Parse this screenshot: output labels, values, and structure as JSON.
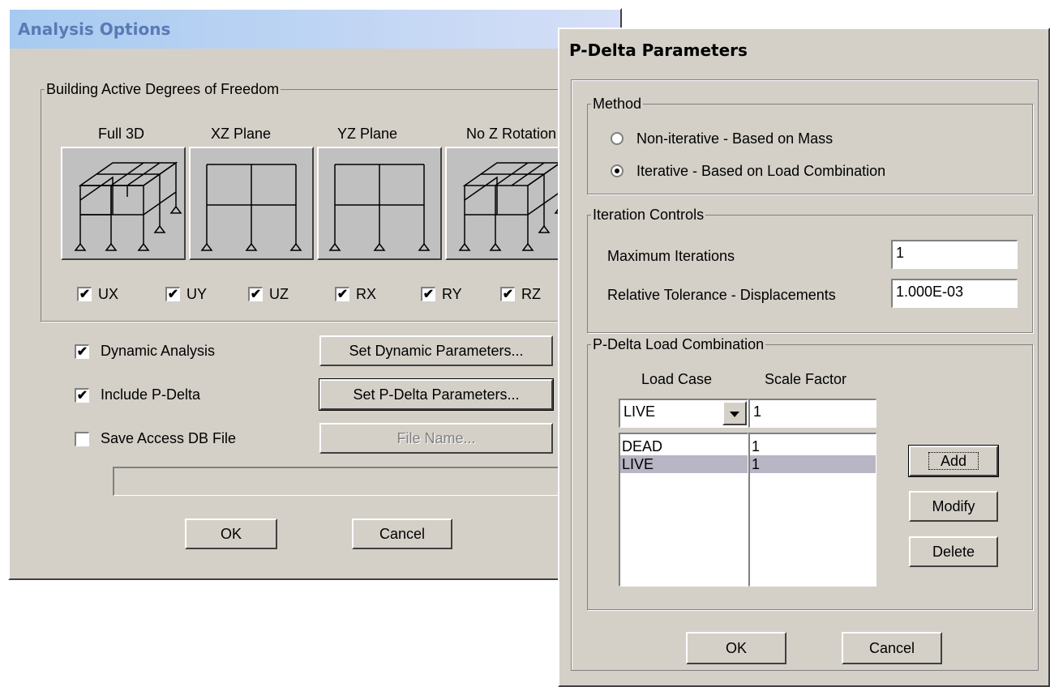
{
  "analysis_options": {
    "title": "Analysis Options",
    "dof_group_label": "Building Active Degrees of Freedom",
    "dof_presets": [
      "Full 3D",
      "XZ Plane",
      "YZ Plane",
      "No Z Rotation"
    ],
    "dof_checks": [
      {
        "label": "UX",
        "checked": true
      },
      {
        "label": "UY",
        "checked": true
      },
      {
        "label": "UZ",
        "checked": true
      },
      {
        "label": "RX",
        "checked": true
      },
      {
        "label": "RY",
        "checked": true
      },
      {
        "label": "RZ",
        "checked": true
      }
    ],
    "dynamic_label": "Dynamic Analysis",
    "dynamic_checked": true,
    "set_dynamic_label": "Set Dynamic Parameters...",
    "pdelta_label": "Include P-Delta",
    "pdelta_checked": true,
    "set_pdelta_label": "Set P-Delta Parameters...",
    "access_label": "Save Access DB File",
    "access_checked": false,
    "file_name_label": "File Name...",
    "file_path_value": "",
    "ok_label": "OK",
    "cancel_label": "Cancel"
  },
  "pdelta": {
    "title": "P-Delta Parameters",
    "method_label": "Method",
    "method_options": [
      "Non-iterative - Based on Mass",
      "Iterative - Based on Load Combination"
    ],
    "method_selected": 1,
    "iteration_label": "Iteration Controls",
    "max_iter_label": "Maximum Iterations",
    "max_iter_value": "1",
    "rel_tol_label": "Relative Tolerance - Displacements",
    "rel_tol_value": "1.000E-03",
    "combo_label": "P-Delta Load Combination",
    "load_case_header": "Load Case",
    "scale_factor_header": "Scale Factor",
    "load_case_value": "LIVE",
    "scale_factor_value": "1",
    "rows": [
      {
        "case": "DEAD",
        "factor": "1",
        "selected": false
      },
      {
        "case": "LIVE",
        "factor": "1",
        "selected": true
      }
    ],
    "add_label": "Add",
    "modify_label": "Modify",
    "delete_label": "Delete",
    "ok_label": "OK",
    "cancel_label": "Cancel"
  },
  "colors": {
    "face": "#d4d0c8",
    "title_gradient_start": "#a6caf0",
    "title_gradient_end": "#d6dff7",
    "selected_row": "#b8b6c4"
  }
}
